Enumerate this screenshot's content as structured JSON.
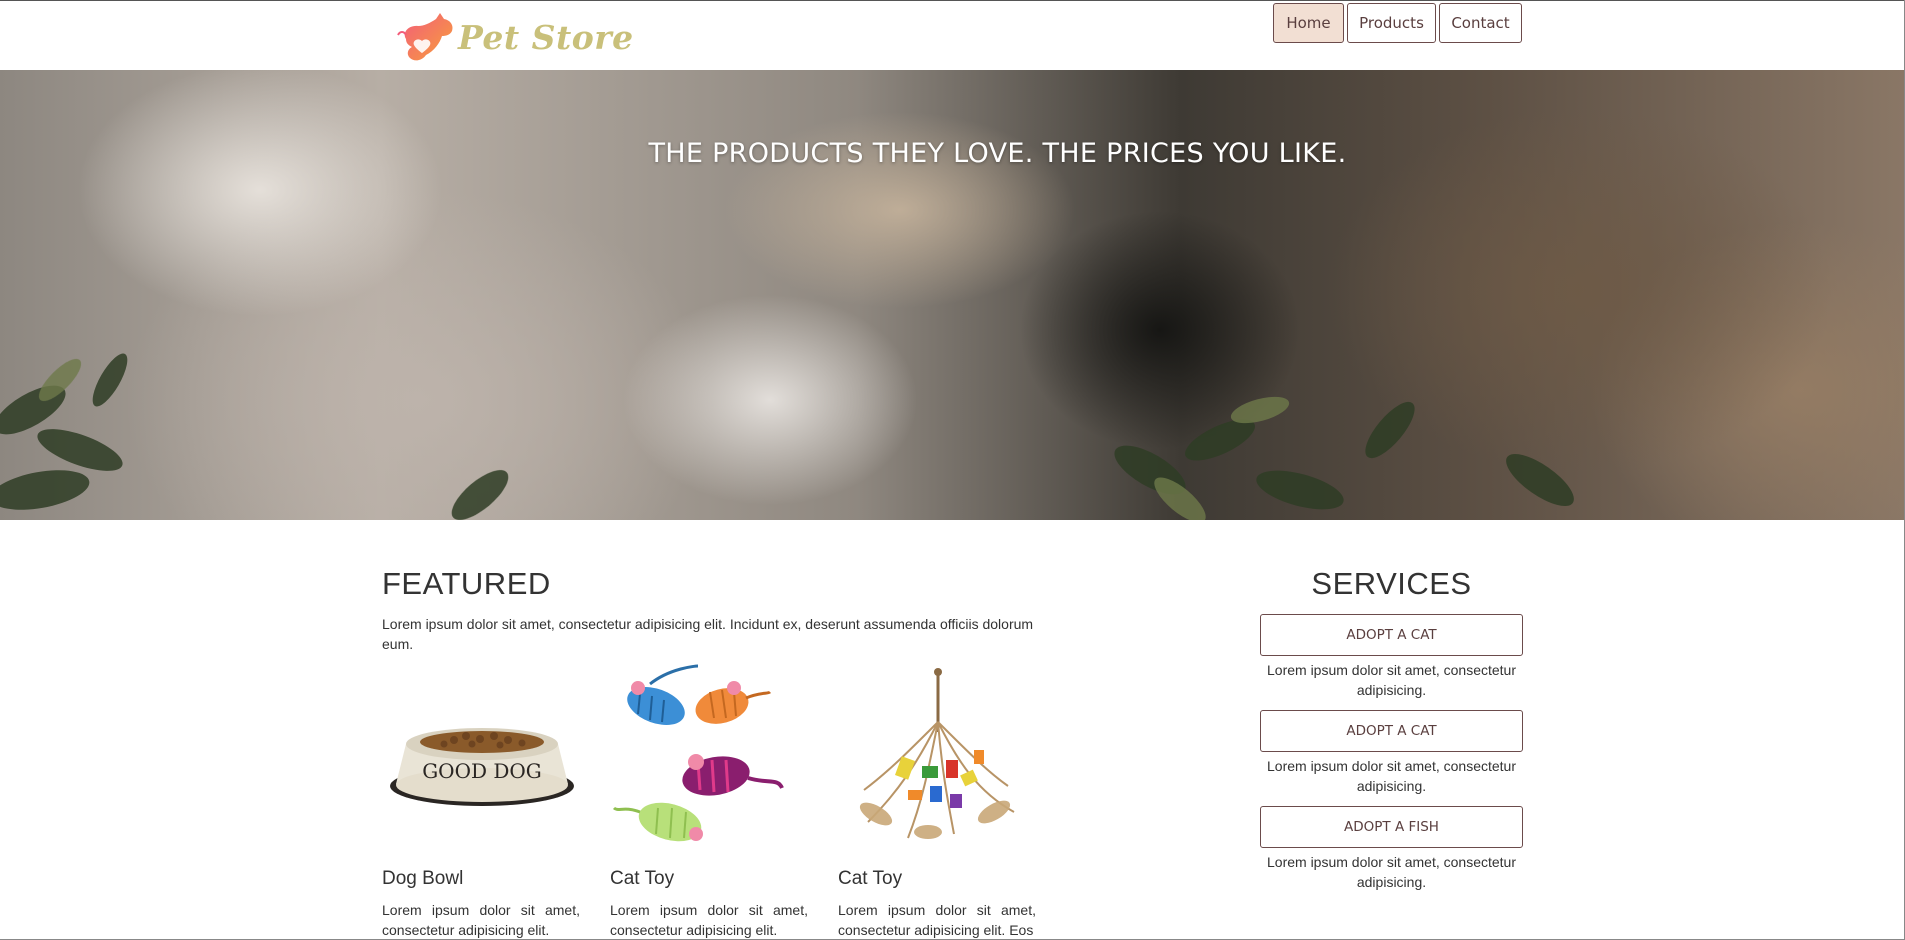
{
  "header": {
    "logo_text": "Pet Store",
    "nav": [
      {
        "label": "Home",
        "active": true
      },
      {
        "label": "Products",
        "active": false
      },
      {
        "label": "Contact",
        "active": false
      }
    ]
  },
  "hero": {
    "headline": "THE PRODUCTS THEY LOVE. THE PRICES YOU LIKE."
  },
  "featured": {
    "title": "FEATURED",
    "description": "Lorem ipsum dolor sit amet, consectetur adipisicing elit. Incidunt ex, deserunt assumenda officiis dolorum eum.",
    "products": [
      {
        "name": "Dog Bowl",
        "bowl_text": "GOOD DOG",
        "description": "Lorem ipsum dolor sit amet, consectetur adipisicing elit."
      },
      {
        "name": "Cat Toy",
        "description": "Lorem ipsum dolor sit amet, consectetur adipisicing elit."
      },
      {
        "name": "Cat Toy",
        "description": "Lorem ipsum dolor sit amet, consectetur adipisicing elit. Eos"
      }
    ]
  },
  "services": {
    "title": "SERVICES",
    "items": [
      {
        "button": "ADOPT A CAT",
        "description": "Lorem ipsum dolor sit amet, consectetur adipisicing."
      },
      {
        "button": "ADOPT A CAT",
        "description": "Lorem ipsum dolor sit amet, consectetur adipisicing."
      },
      {
        "button": "ADOPT A FISH",
        "description": "Lorem ipsum dolor sit amet, consectetur adipisicing."
      }
    ]
  },
  "colors": {
    "accent": "#6b4b4b",
    "nav_active_bg": "#f2dfd3",
    "logo_text": "#c9c07a",
    "logo_icon": "#f07a5a"
  },
  "icons": {
    "logo": "pet-logo-icon"
  }
}
